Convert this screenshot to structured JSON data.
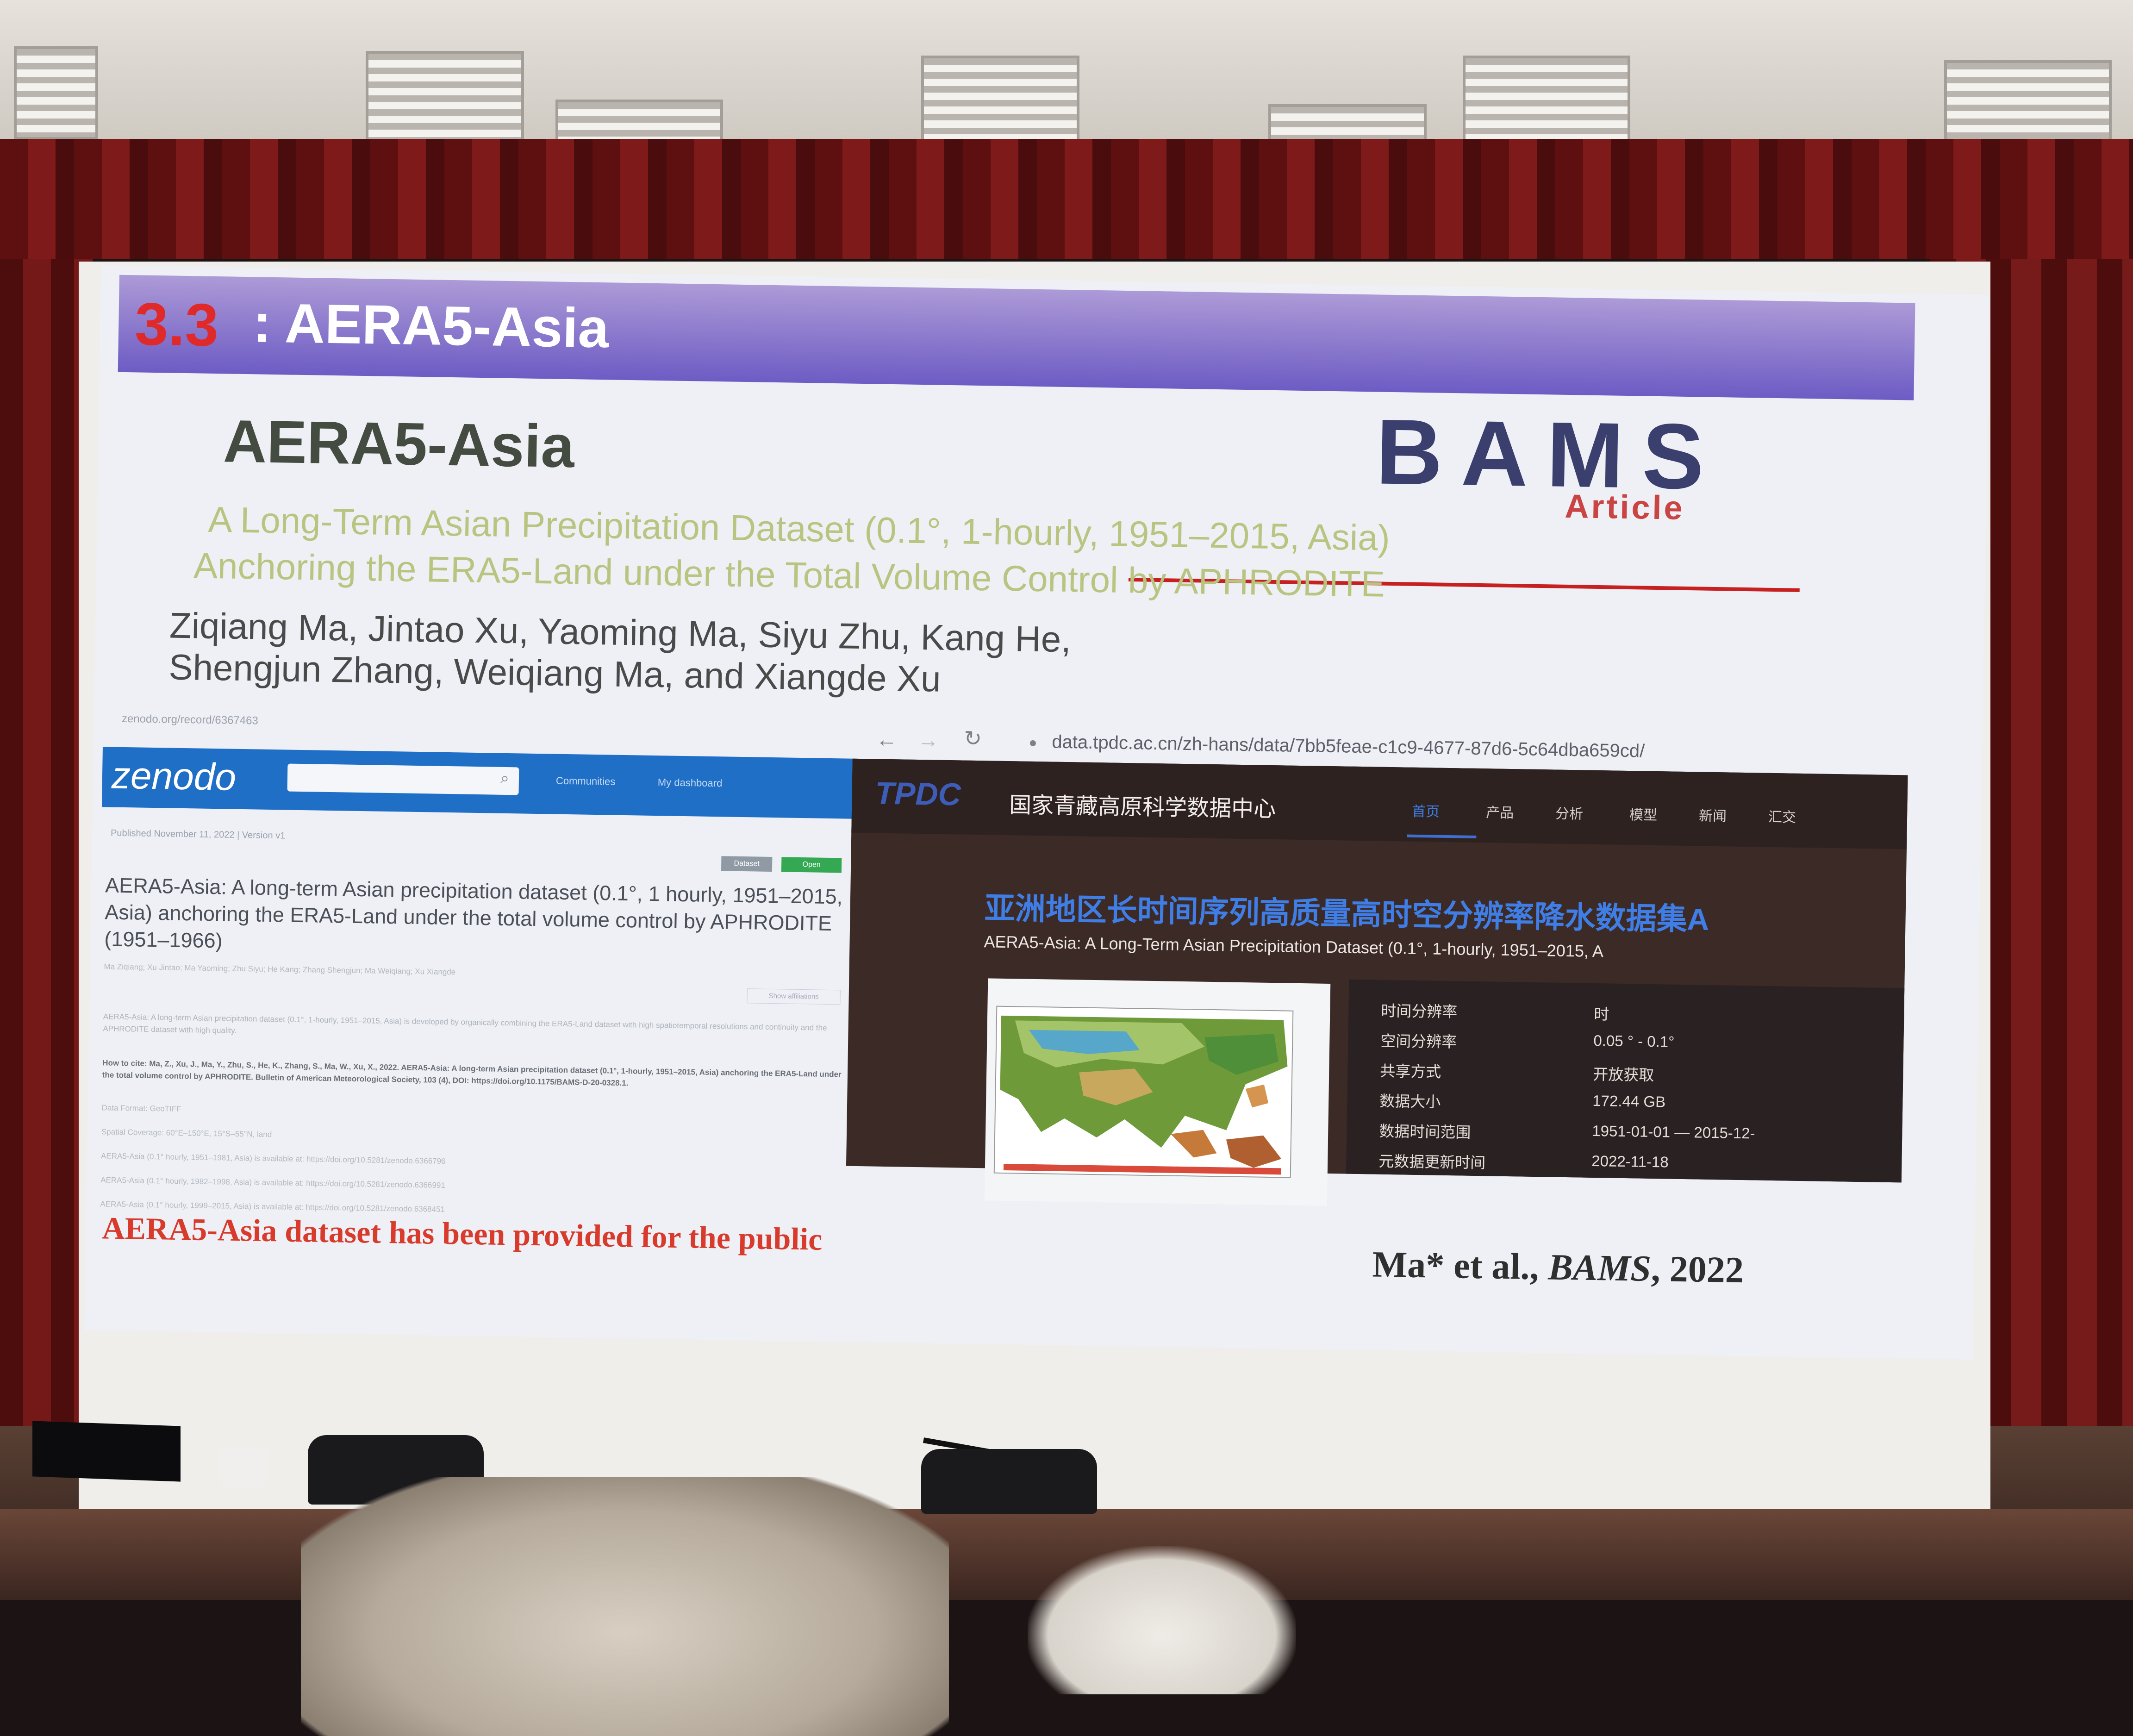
{
  "slide": {
    "section_number": "3.3",
    "title": ": AERA5-Asia",
    "paper_title": "AERA5-Asia",
    "bams_logo": "BAMS",
    "bams_article": "Article",
    "subtitle_line1": "A Long-Term Asian Precipitation Dataset (0.1°, 1-hourly, 1951–2015, Asia)",
    "subtitle_line2": "Anchoring the ERA5-Land under the Total Volume Control by APHRODITE",
    "authors_line1": "Ziqiang Ma, Jintao Xu, Yaoming Ma, Siyu Zhu, Kang He,",
    "authors_line2": "Shengjun Zhang, Weiqiang Ma, and Xiangde Xu",
    "footer_note": "AERA5-Asia dataset has been provided for the public",
    "citation_author": "Ma* et al., ",
    "citation_journal": "BAMS",
    "citation_year": ", 2022"
  },
  "zenodo": {
    "url": "zenodo.org/record/6367463",
    "logo": "zenodo",
    "nav_communities": "Communities",
    "nav_upload": "My dashboard",
    "published": "Published November 11, 2022 | Version v1",
    "btn_dataset": "Dataset",
    "btn_open": "Open",
    "record_title": "AERA5-Asia: A long-term Asian precipitation dataset (0.1°, 1 hourly, 1951–2015, Asia) anchoring the ERA5-Land under the total volume control by APHRODITE (1951–1966)",
    "authors": "Ma Ziqiang; Xu Jintao; Ma Yaoming; Zhu Siyu; He Kang; Zhang Shengjun; Ma Weiqiang; Xu Xiangde",
    "versions": "Show affiliations",
    "abstract": "AERA5-Asia: A long-term Asian precipitation dataset (0.1°, 1-hourly, 1951–2015, Asia) is developed by organically combining the ERA5-Land dataset with high spatiotemporal resolutions and continuity and the APHRODITE dataset with high quality.",
    "cite": "How to cite: Ma, Z., Xu, J., Ma, Y., Zhu, S., He, K., Zhang, S., Ma, W., Xu, X., 2022. AERA5-Asia: A long-term Asian precipitation dataset (0.1°, 1-hourly, 1951–2015, Asia) anchoring the ERA5-Land under the total volume control by APHRODITE. Bulletin of American Meteorological Society, 103 (4), DOI: https://doi.org/10.1175/BAMS-D-20-0328.1.",
    "meta": [
      "Data Format: GeoTIFF",
      "Spatial Coverage: 60°E–150°E, 15°S–55°N, land",
      "AERA5-Asia (0.1° hourly, 1951–1981, Asia) is available at: https://doi.org/10.5281/zenodo.6366796",
      "AERA5-Asia (0.1° hourly, 1982–1998, Asia) is available at: https://doi.org/10.5281/zenodo.6366991",
      "AERA5-Asia (0.1° hourly, 1999–2015, Asia) is available at: https://doi.org/10.5281/zenodo.6368451"
    ]
  },
  "tpdc": {
    "browser_url": "data.tpdc.ac.cn/zh-hans/data/7bb5feae-c1c9-4677-87d6-5c64dba659cd/",
    "logo": "TPDC",
    "site_name": "国家青藏高原科学数据中心",
    "nav": [
      "首页",
      "产品",
      "分析",
      "模型",
      "新闻",
      "汇交"
    ],
    "cn_title": "亚洲地区长时间序列高质量高时空分辨率降水数据集A",
    "en_title": "AERA5-Asia: A Long-Term Asian Precipitation Dataset (0.1°, 1-hourly, 1951–2015, A",
    "meta": [
      {
        "key": "时间分辨率",
        "value": "时"
      },
      {
        "key": "空间分辨率",
        "value": "0.05 ° - 0.1°"
      },
      {
        "key": "共享方式",
        "value": "开放获取"
      },
      {
        "key": "数据大小",
        "value": "172.44 GB"
      },
      {
        "key": "数据时间范围",
        "value": "1951-01-01 — 2015-12-"
      },
      {
        "key": "元数据更新时间",
        "value": "2022-11-18"
      }
    ]
  }
}
